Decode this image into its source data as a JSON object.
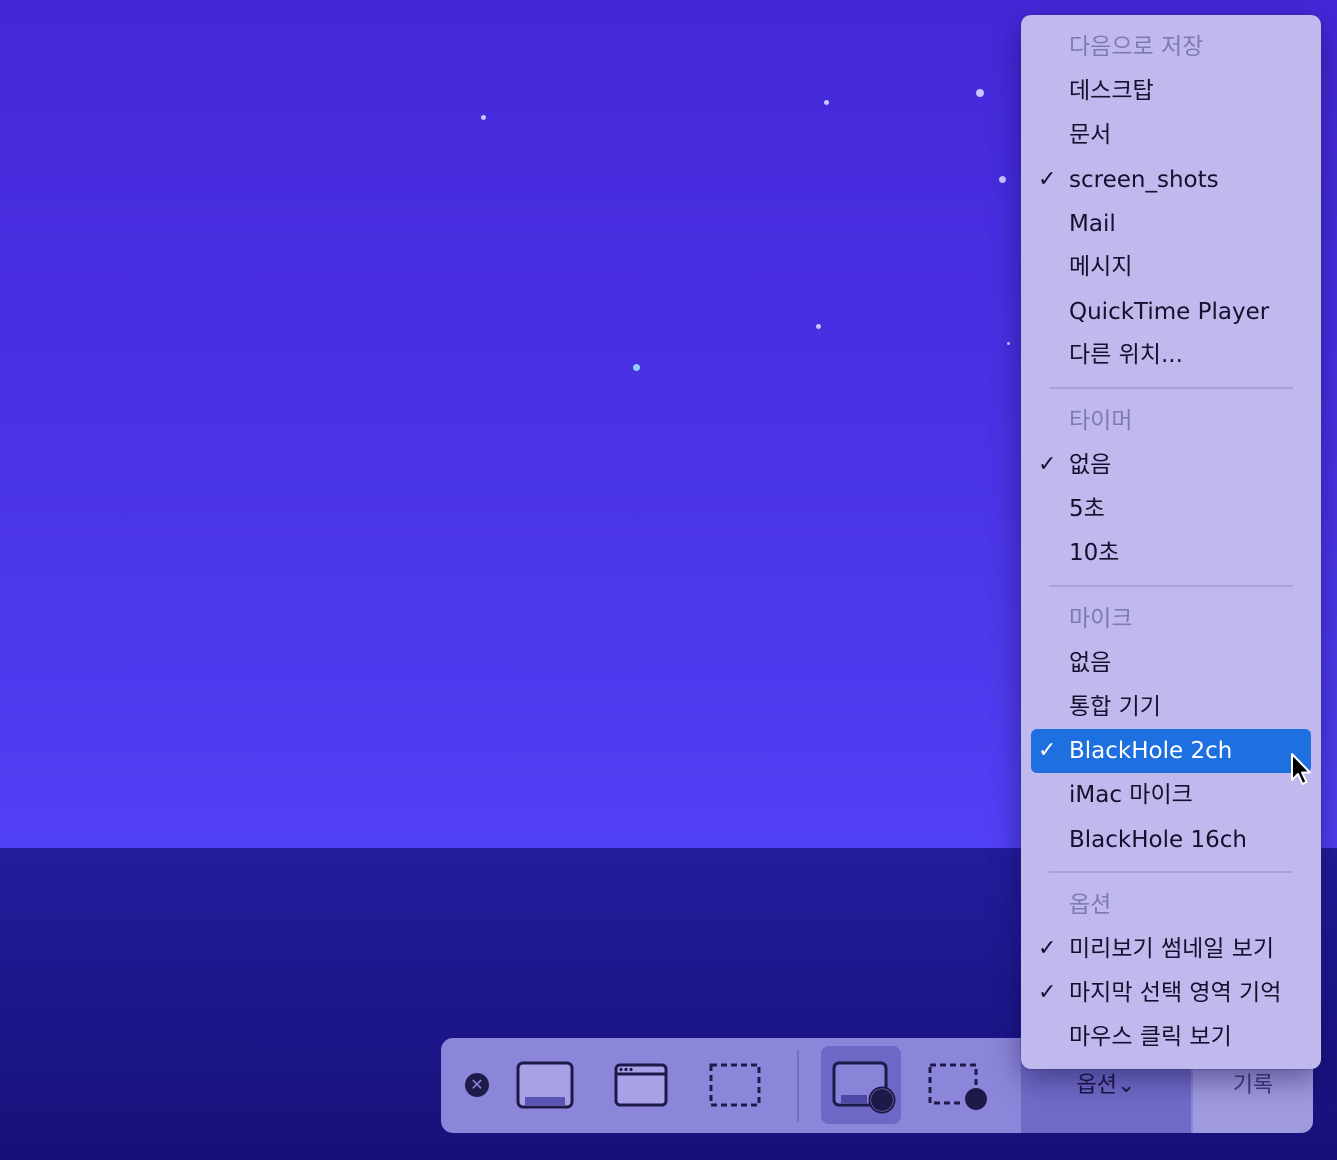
{
  "menu": {
    "save_to": {
      "header": "다음으로 저장",
      "items": [
        {
          "label": "데스크탑",
          "checked": false
        },
        {
          "label": "문서",
          "checked": false
        },
        {
          "label": "screen_shots",
          "checked": true
        },
        {
          "label": "Mail",
          "checked": false
        },
        {
          "label": "메시지",
          "checked": false
        },
        {
          "label": "QuickTime Player",
          "checked": false
        },
        {
          "label": "다른 위치...",
          "checked": false
        }
      ]
    },
    "timer": {
      "header": "타이머",
      "items": [
        {
          "label": "없음",
          "checked": true
        },
        {
          "label": "5초",
          "checked": false
        },
        {
          "label": "10초",
          "checked": false
        }
      ]
    },
    "microphone": {
      "header": "마이크",
      "items": [
        {
          "label": "없음",
          "checked": false
        },
        {
          "label": "통합 기기",
          "checked": false
        },
        {
          "label": "BlackHole 2ch",
          "checked": true,
          "highlighted": true
        },
        {
          "label": "iMac 마이크",
          "checked": false
        },
        {
          "label": "BlackHole 16ch",
          "checked": false
        }
      ]
    },
    "options": {
      "header": "옵션",
      "items": [
        {
          "label": "미리보기 썸네일 보기",
          "checked": true
        },
        {
          "label": "마지막 선택 영역 기억",
          "checked": true
        },
        {
          "label": "마우스 클릭 보기",
          "checked": false
        }
      ]
    },
    "check_glyph": "✓",
    "highlight_color": "#1e6fe0"
  },
  "toolbar": {
    "close_glyph": "✕",
    "close_icon": "close-circle-icon",
    "buttons": [
      {
        "name": "capture-entire-screen",
        "icon": "entire-screen-icon",
        "active": false
      },
      {
        "name": "capture-selected-window",
        "icon": "window-icon",
        "active": false
      },
      {
        "name": "capture-selected-portion",
        "icon": "dashed-selection-icon",
        "active": false
      },
      {
        "name": "record-entire-screen",
        "icon": "record-screen-icon",
        "active": true
      },
      {
        "name": "record-selected-portion",
        "icon": "record-selection-icon",
        "active": false
      }
    ],
    "options_label": "옵션",
    "options_chevron": "⌄",
    "record_label": "기록"
  }
}
